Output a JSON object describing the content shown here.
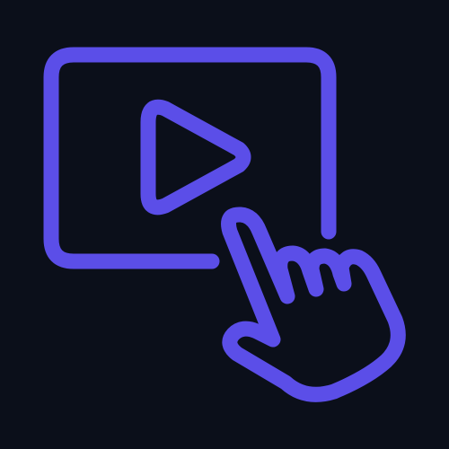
{
  "background_color": "#0b0f1a",
  "accent_color": "#5b4ee8",
  "icon": "video-play-click-icon",
  "parts": {
    "screen": "video-screen-icon",
    "play": "play-button-icon",
    "hand": "pointing-hand-icon"
  }
}
